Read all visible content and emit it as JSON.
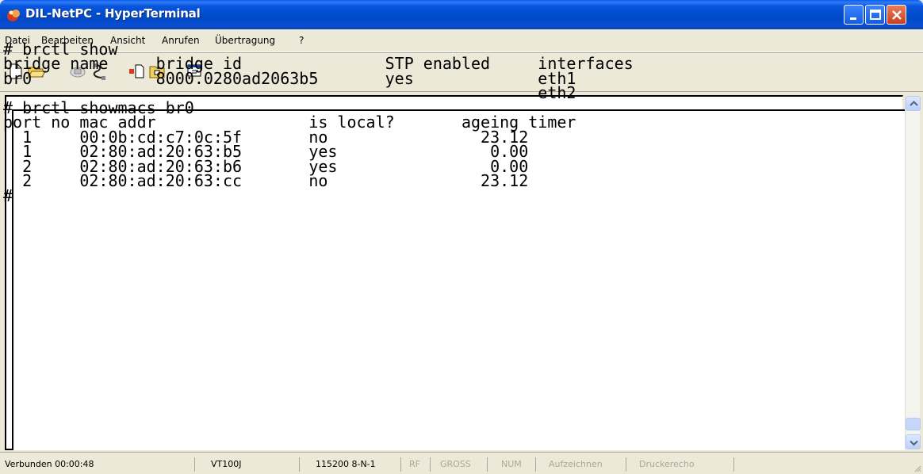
{
  "window": {
    "title": "DIL-NetPC - HyperTerminal"
  },
  "menu": {
    "items": [
      "Datei",
      "Bearbeiten",
      "Ansicht",
      "Anrufen",
      "Übertragung",
      "?"
    ]
  },
  "terminal": {
    "lines": [
      "",
      "# brctl show",
      "bridge name     bridge id               STP enabled     interfaces",
      "br0             8000.0280ad2063b5       yes             eth1",
      "                                                        eth2",
      "# brctl showmacs br0",
      "port no mac addr                is local?       ageing timer",
      "  1     00:0b:cd:c7:0c:5f       no                23.12",
      "  1     02:80:ad:20:63:b5       yes                0.00",
      "  2     02:80:ad:20:63:b6       yes                0.00",
      "  2     02:80:ad:20:63:cc       no                23.12",
      "#"
    ]
  },
  "status": {
    "connected": "Verbunden 00:00:48",
    "emulation": "VT100J",
    "settings": "115200 8-N-1",
    "rf": "RF",
    "gross": "GROSS",
    "num": "NUM",
    "capture": "Aufzeichnen",
    "printecho": "Druckerecho"
  },
  "icons": {
    "app": "hyperterminal-icon",
    "tools": [
      "new-icon",
      "open-icon",
      "disconnect-icon",
      "connect-icon",
      "send-icon",
      "receive-icon",
      "properties-icon"
    ]
  }
}
